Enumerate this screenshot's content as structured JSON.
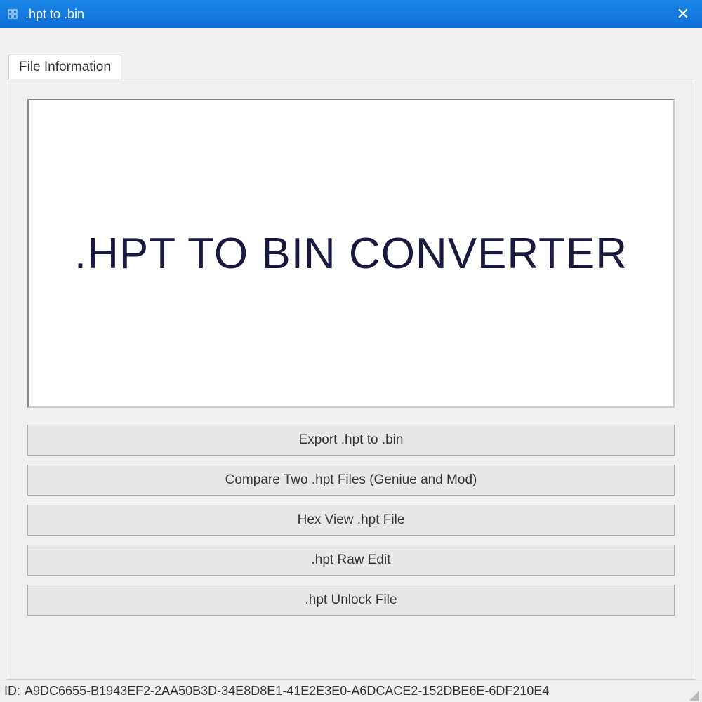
{
  "titlebar": {
    "title": ".hpt to .bin",
    "close_icon": "✕"
  },
  "tabs": {
    "file_info_label": "File Information"
  },
  "main": {
    "heading": ".HPT TO BIN CONVERTER"
  },
  "buttons": {
    "export_label": "Export .hpt to .bin",
    "compare_label": "Compare Two .hpt Files (Geniue and Mod)",
    "hexview_label": "Hex View .hpt File",
    "rawedit_label": ".hpt Raw Edit",
    "unlock_label": ".hpt Unlock File"
  },
  "statusbar": {
    "id_prefix": "ID:",
    "id_value": "A9DC6655-B1943EF2-2AA50B3D-34E8D8E1-41E2E3E0-A6DCACE2-152DBE6E-6DF210E4"
  }
}
